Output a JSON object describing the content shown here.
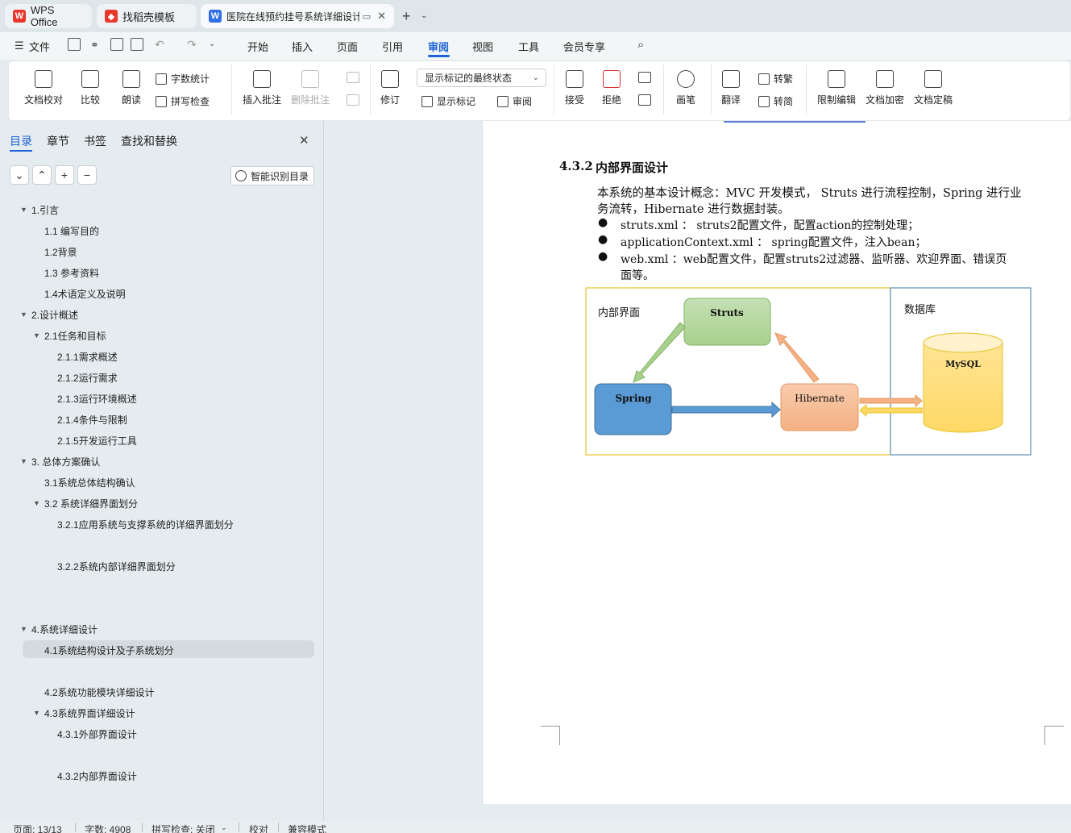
{
  "tabs": [
    {
      "label": "WPS Office"
    },
    {
      "label": "找稻壳模板"
    },
    {
      "label": "医院在线预约挂号系统详细设计"
    }
  ],
  "menu": {
    "file": "文件",
    "items": [
      "开始",
      "插入",
      "页面",
      "引用",
      "审阅",
      "视图",
      "工具",
      "会员专享"
    ],
    "active": "审阅"
  },
  "ribbon": {
    "doc_check": "文档校对",
    "compare": "比较",
    "read": "朗读",
    "word_count": "字数统计",
    "spell_check": "拼写检查",
    "insert_comment": "插入批注",
    "delete_comment": "删除批注",
    "track": "修订",
    "show_markup": "显示标记",
    "review": "审阅",
    "markup_state": "显示标记的最终状态",
    "accept": "接受",
    "reject": "拒绝",
    "pen": "画笔",
    "translate": "翻译",
    "to_trad": "转繁",
    "to_simp": "转简",
    "restrict": "限制编辑",
    "encrypt": "文档加密",
    "finalize": "文档定稿"
  },
  "sidebar": {
    "tabs": [
      "目录",
      "章节",
      "书签",
      "查找和替换"
    ],
    "smart": "智能识别目录",
    "toc": [
      {
        "label": "1.引言"
      },
      {
        "label": "1.1 编写目的"
      },
      {
        "label": "1.2背景"
      },
      {
        "label": "1.3 参考资料"
      },
      {
        "label": "1.4术语定义及说明"
      },
      {
        "label": "2.设计概述"
      },
      {
        "label": "2.1任务和目标"
      },
      {
        "label": "2.1.1需求概述"
      },
      {
        "label": "2.1.2运行需求"
      },
      {
        "label": "2.1.3运行环境概述"
      },
      {
        "label": "2.1.4条件与限制"
      },
      {
        "label": "2.1.5开发运行工具"
      },
      {
        "label": "3.  总体方案确认"
      },
      {
        "label": "3.1系统总体结构确认"
      },
      {
        "label": "3.2  系统详细界面划分"
      },
      {
        "label": "3.2.1应用系统与支撑系统的详细界面划分"
      },
      {
        "label": "3.2.2系统内部详细界面划分"
      },
      {
        "label": "4.系统详细设计"
      },
      {
        "label": "4.1系统结构设计及子系统划分"
      },
      {
        "label": "4.2系统功能模块详细设计"
      },
      {
        "label": "4.3系统界面详细设计"
      },
      {
        "label": "4.3.1外部界面设计"
      },
      {
        "label": "4.3.2内部界面设计"
      }
    ]
  },
  "doc": {
    "heading_num": "4.3.2",
    "heading": "内部界面设计",
    "p1a": "本系统的基本设计概念：MVC 开发模式， Struts 进行流程控制，Spring 进行业",
    "p1b": "务流转，Hibernate 进行数据封装。",
    "b1": "struts.xml ： struts2配置文件，配置action的控制处理；",
    "b2": "applicationContext.xml ： spring配置文件，注入bean；",
    "b3a": "web.xml ：web配置文件，配置struts2过滤器、监听器、欢迎界面、错误页",
    "b3b": "面等。",
    "diagram": {
      "inner": "内部界面",
      "db": "数据库",
      "struts": "Struts",
      "spring": "Spring",
      "hibernate": "Hibernate",
      "mysql": "MySQL"
    }
  },
  "status": {
    "page": "页面: 13/13",
    "words": "字数: 4908",
    "spell": "拼写检查: 关闭",
    "proof": "校对",
    "compat": "兼容模式"
  },
  "colors": {
    "accent": "#1d62d8",
    "struts": "#a9d18e",
    "spring": "#5b9bd5",
    "hibernate": "#f4b183",
    "mysql": "#ffd966"
  }
}
